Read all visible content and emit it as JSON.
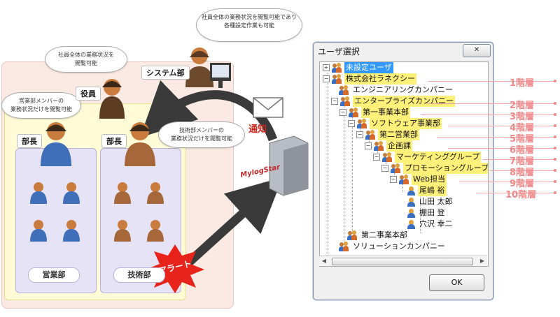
{
  "diagram": {
    "notes": {
      "system_note": "社員全体の業務状況を閲覧可能であり\n各種設定作業も可能",
      "exec_note": "社員全体の業務状況を\n閲覧可能",
      "sales_note": "営業部メンバーの\n業務状況だけを閲覧可能",
      "tech_note": "技術部メンバーの\n業務状況だけを閲覧可能"
    },
    "labels": {
      "system_dept": "システム部",
      "executive": "役員",
      "manager_sales": "部長",
      "manager_tech": "部長",
      "sales_dept": "営業部",
      "tech_dept": "技術部",
      "notify": "通知",
      "alert": "アラート",
      "product_logo": "MylogStar"
    },
    "colors": {
      "arrow": "#3a3a3a",
      "alert": "#e8231c",
      "notify": "#d1261c"
    }
  },
  "dialog": {
    "title": "ユーザ選択",
    "close_label": "✕",
    "ok_label": "OK",
    "tree": [
      {
        "label": "未設定ユーザ",
        "selected": true
      },
      {
        "label": "株式会社ラネクシー",
        "highlight": true
      },
      {
        "label": "エンジニアリングカンパニー"
      },
      {
        "label": "エンタープライズカンパニー",
        "highlight": true
      },
      {
        "label": "第一事業本部",
        "highlight": true
      },
      {
        "label": "ソフトウェア事業部",
        "highlight": true
      },
      {
        "label": "第二営業部",
        "highlight": true
      },
      {
        "label": "企画課",
        "highlight": true
      },
      {
        "label": "マーケティンググループ",
        "highlight": true
      },
      {
        "label": "プロモーショングループ",
        "highlight": true
      },
      {
        "label": "Web担当",
        "highlight": true
      },
      {
        "label": "尾嶋 裕",
        "highlight": true
      },
      {
        "label": "山田 太郎"
      },
      {
        "label": "棚田 登"
      },
      {
        "label": "穴沢 幸二"
      },
      {
        "label": "第二事業本部"
      },
      {
        "label": "ソリューションカンパニー"
      }
    ]
  },
  "levels": [
    "1階層",
    "2階層",
    "3階層",
    "4階層",
    "5階層",
    "6階層",
    "7階層",
    "8階層",
    "9階層",
    "10階層"
  ]
}
